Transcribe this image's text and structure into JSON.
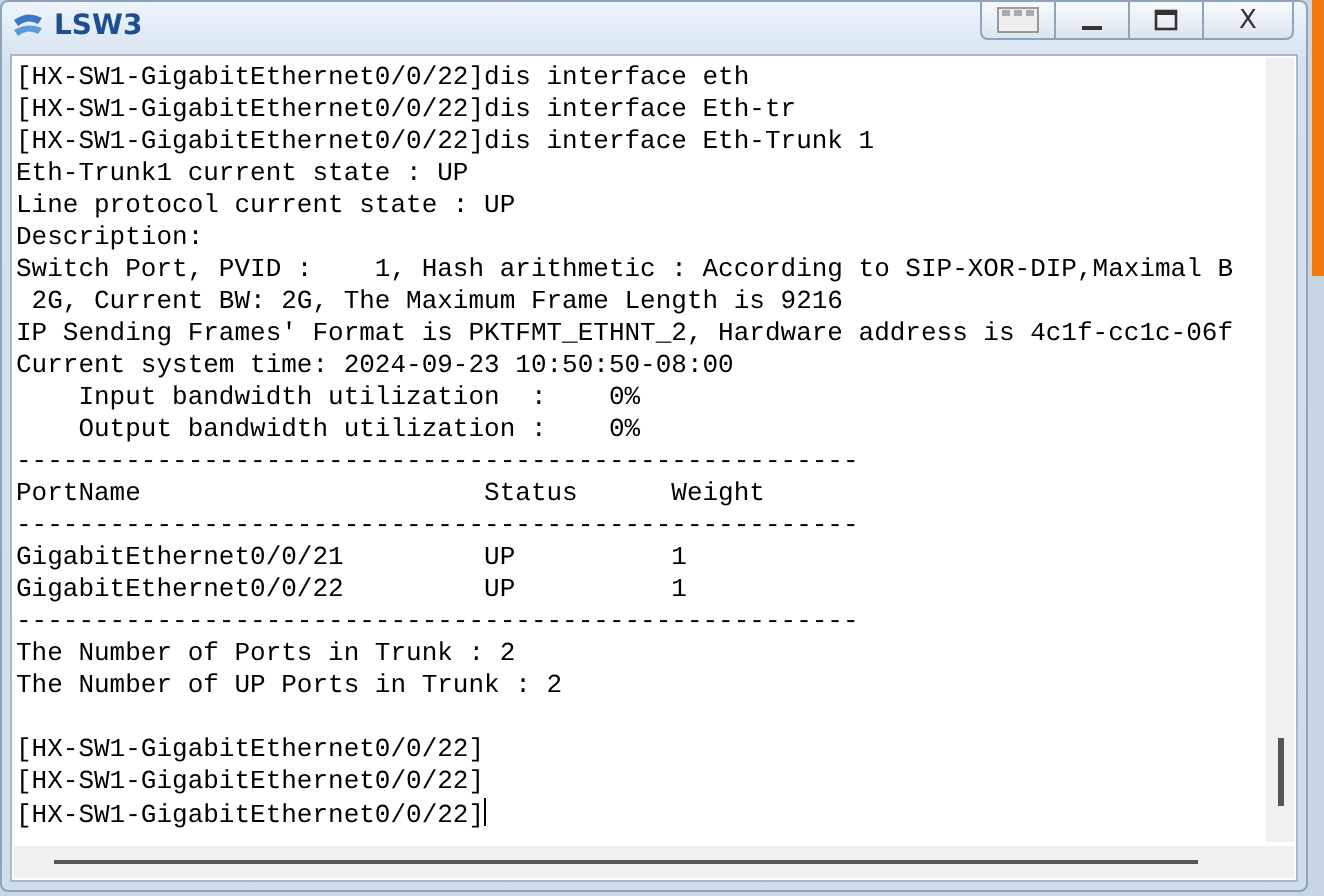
{
  "window": {
    "title": "LSW3",
    "close_label": "X"
  },
  "terminal": {
    "lines": [
      {
        "kind": "text",
        "text": "[HX-SW1-GigabitEthernet0/0/22]dis interface eth"
      },
      {
        "kind": "text",
        "text": "[HX-SW1-GigabitEthernet0/0/22]dis interface Eth-tr"
      },
      {
        "kind": "text",
        "text": "[HX-SW1-GigabitEthernet0/0/22]dis interface Eth-Trunk 1"
      },
      {
        "kind": "text",
        "text": "Eth-Trunk1 current state : UP"
      },
      {
        "kind": "text",
        "text": "Line protocol current state : UP"
      },
      {
        "kind": "text",
        "text": "Description:"
      },
      {
        "kind": "text",
        "text": "Switch Port, PVID :    1, Hash arithmetic : According to SIP-XOR-DIP,Maximal B"
      },
      {
        "kind": "text",
        "text": " 2G, Current BW: 2G, The Maximum Frame Length is 9216"
      },
      {
        "kind": "text",
        "text": "IP Sending Frames' Format is PKTFMT_ETHNT_2, Hardware address is 4c1f-cc1c-06f"
      },
      {
        "kind": "text",
        "text": "Current system time: 2024-09-23 10:50:50-08:00"
      },
      {
        "kind": "text",
        "text": "    Input bandwidth utilization  :    0%"
      },
      {
        "kind": "text",
        "text": "    Output bandwidth utilization :    0%"
      },
      {
        "kind": "text",
        "text": "------------------------------------------------------"
      },
      {
        "kind": "text",
        "text": "PortName                      Status      Weight"
      },
      {
        "kind": "text",
        "text": "------------------------------------------------------"
      },
      {
        "kind": "text",
        "text": "GigabitEthernet0/0/21         UP          1"
      },
      {
        "kind": "text",
        "text": "GigabitEthernet0/0/22         UP          1"
      },
      {
        "kind": "text",
        "text": "------------------------------------------------------"
      },
      {
        "kind": "text",
        "text": "The Number of Ports in Trunk : 2"
      },
      {
        "kind": "text",
        "text": "The Number of UP Ports in Trunk : 2"
      },
      {
        "kind": "blank"
      },
      {
        "kind": "text",
        "text": "[HX-SW1-GigabitEthernet0/0/22]"
      },
      {
        "kind": "text",
        "text": "[HX-SW1-GigabitEthernet0/0/22]"
      },
      {
        "kind": "text",
        "text": "[HX-SW1-GigabitEthernet0/0/22]",
        "cursor": true
      }
    ]
  }
}
